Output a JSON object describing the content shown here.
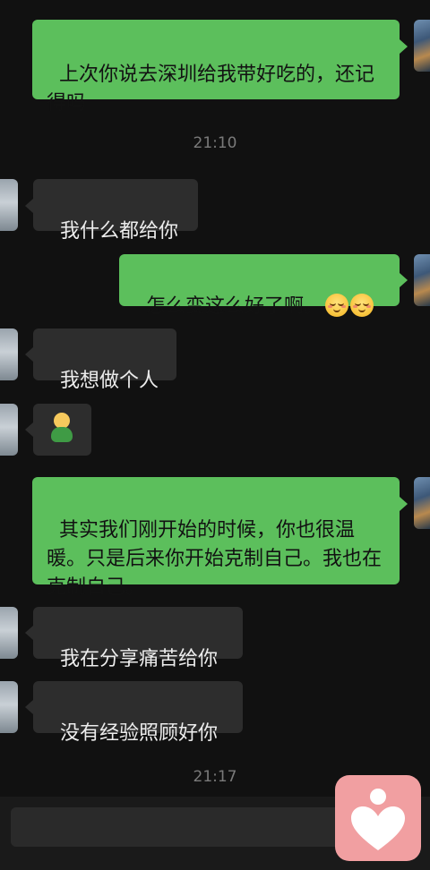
{
  "messages": [
    {
      "side": "me",
      "text": "上次你说去深圳给我带好吃的，还记得吗"
    },
    {
      "side": "them",
      "text": "我什么都给你"
    },
    {
      "side": "me",
      "text": "怎么变这么好了啊。"
    },
    {
      "side": "them",
      "text": "我想做个人"
    },
    {
      "side": "them",
      "sticker": "person-sticker"
    },
    {
      "side": "me",
      "text": "其实我们刚开始的时候，你也很温暖。只是后来你开始克制自己。我也在克制自己。"
    },
    {
      "side": "them",
      "text": "我在分享痛苦给你"
    },
    {
      "side": "them",
      "text": "没有经验照顾好你"
    }
  ],
  "timestamps": [
    "21:10",
    "21:17"
  ],
  "emoji": [
    "smiling-face-emoji",
    "smiling-face-emoji"
  ],
  "colors": {
    "background": "#111111",
    "me_bubble": "#5cbf5c",
    "them_bubble": "#2d2d2d",
    "logo": "#f19fa1"
  },
  "icons": [
    "heart-person-logo"
  ]
}
